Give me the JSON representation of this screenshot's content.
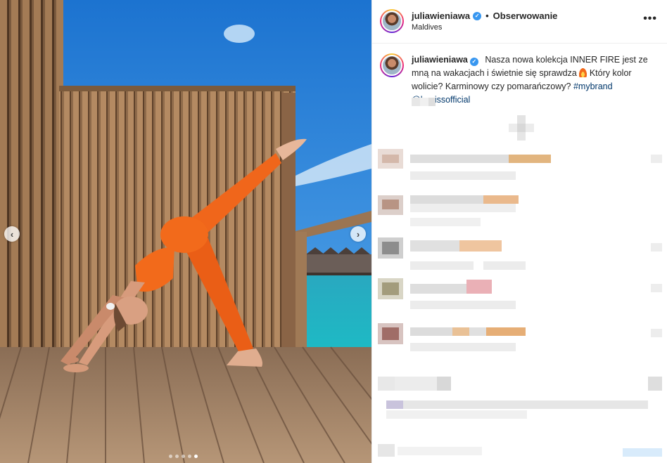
{
  "post": {
    "username": "juliawieniawa",
    "follow_label": "Obserwowanie",
    "location": "Maldives",
    "more_label": "•••",
    "separator": "•",
    "verified_mark": "✓"
  },
  "caption": {
    "username": "juliawieniawa",
    "text_before": "Nasza nowa kolekcja INNER FIRE jest ze mną na wakacjach i świetnie się sprawdza",
    "text_after": "Który kolor wolicie? Karminowy czy pomarańczowy?",
    "hashtag": "#mybrand",
    "mention": "@lemissofficial",
    "emoji": "flame-emoji"
  },
  "carousel": {
    "prev_label": "‹",
    "next_label": "›",
    "dots": 5,
    "active_dot": 5
  },
  "colors": {
    "accent_blue": "#3897f0",
    "link_blue": "#00376b",
    "sky": "#2a8bd9",
    "outfit_orange": "#f26a1b"
  }
}
